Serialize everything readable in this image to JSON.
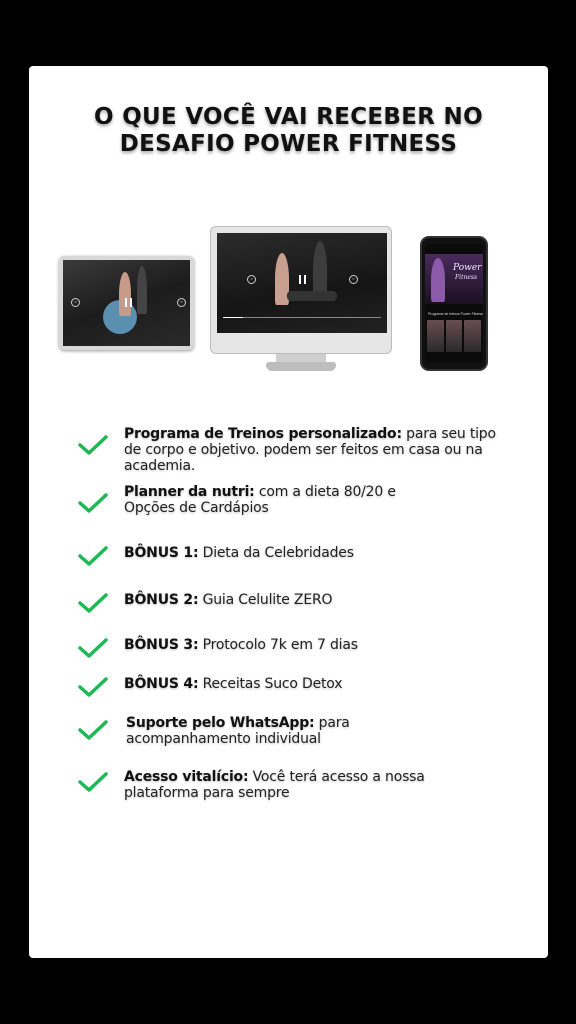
{
  "heading": {
    "line1": "O QUE VOCÊ VAI RECEBER NO",
    "line2": "DESAFIO POWER FITNESS"
  },
  "devices": {
    "phone_brand_line1": "Power",
    "phone_brand_line2": "Fitness",
    "phone_subtitle": "Programa de treinos Power Fitness"
  },
  "items": [
    {
      "bold": "Programa de Treinos personalizado:",
      "line1_rest": " para seu tipo",
      "line2": "de corpo e objetivo. podem ser feitos em casa ou na",
      "line3": "academia."
    },
    {
      "bold": "Planner da nutri:",
      "line1_rest": "  com a dieta 80/20 e",
      "line2": "Opções de Cardápios"
    },
    {
      "bold": "BÔNUS 1:",
      "line1_rest": " Dieta da Celebridades"
    },
    {
      "bold": "BÔNUS 2:",
      "line1_rest": " Guia Celulite ZERO"
    },
    {
      "bold": "BÔNUS 3:",
      "line1_rest": " Protocolo 7k em 7 dias"
    },
    {
      "bold": "BÔNUS 4:",
      "line1_rest": " Receitas Suco Detox"
    },
    {
      "bold": "Suporte pelo WhatsApp:",
      "line1_rest": " para",
      "line2": "acompanhamento individual"
    },
    {
      "bold": "Acesso vitalício:",
      "line1_rest": " Você terá acesso a nossa",
      "line2": "plataforma para sempre"
    }
  ],
  "colors": {
    "check": "#1db954",
    "card": "#ffffff",
    "background": "#000000"
  },
  "icons": {
    "check": "check-icon",
    "pause": "pause-icon"
  }
}
